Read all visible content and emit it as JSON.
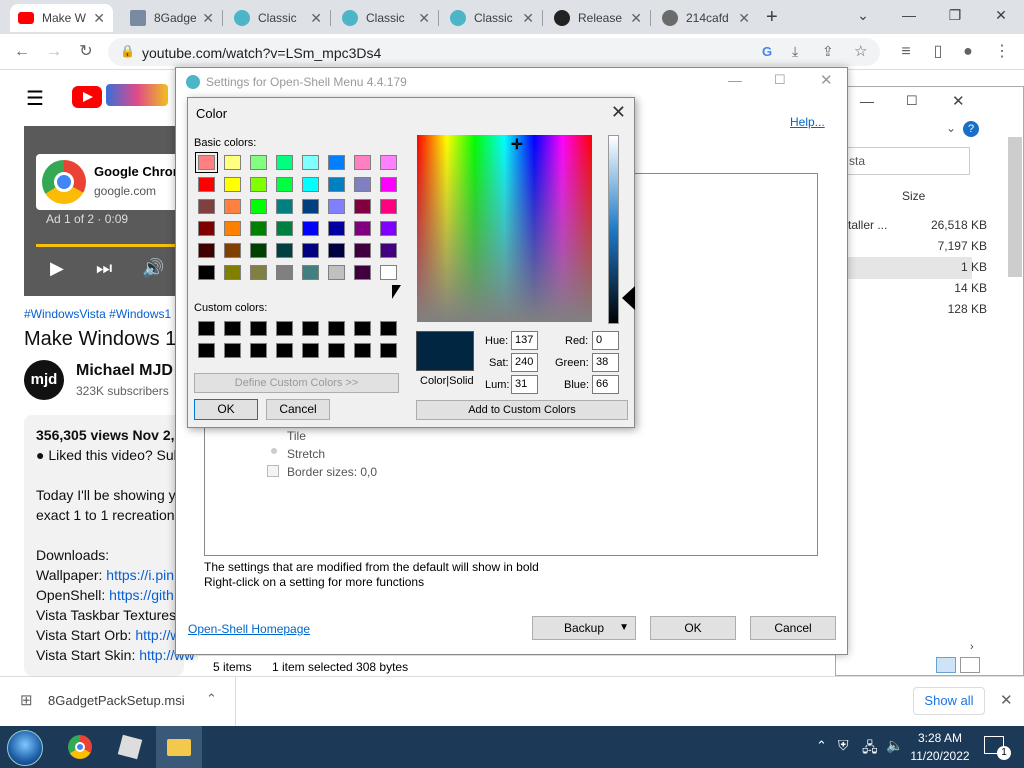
{
  "browser": {
    "tabs": [
      {
        "label": "Make W",
        "active": true
      },
      {
        "label": "8Gadge"
      },
      {
        "label": "Classic"
      },
      {
        "label": "Classic"
      },
      {
        "label": "Classic"
      },
      {
        "label": "Release"
      },
      {
        "label": "214cafd"
      }
    ],
    "new_tab": "+",
    "url": "youtube.com/watch?v=LSm_mpc3Ds4"
  },
  "youtube": {
    "ad_title": "Google Chron",
    "ad_domain": "google.com",
    "ad_meta": "Ad 1 of 2 · 0:09",
    "hashtags": "#WindowsVista #Windows1",
    "video_title": "Make Windows 10",
    "channel_name": "Michael MJD",
    "subscribers": "323K subscribers",
    "avatar_text": "mjd",
    "views": "356,305 views  Nov 2,",
    "desc_line1": "● Liked this video? Sub",
    "desc_line2": "Today I'll be showing y",
    "desc_line3": "exact 1 to 1 recreation",
    "downloads": "Downloads:",
    "wallpaper_label": "Wallpaper:",
    "wallpaper_link": "https://i.pin",
    "openshell_label": "OpenShell:",
    "openshell_link": "https://gith",
    "taskbar_textures": "Vista Taskbar Textures",
    "start_orb_label": "Vista Start Orb:",
    "start_orb_link": "http://w",
    "start_skin_label": "Vista Start Skin:",
    "start_skin_link": "http://ww"
  },
  "explorer": {
    "search_text": "sta",
    "col_size": "Size",
    "rows": [
      {
        "name": "taller ...",
        "size": "26,518 KB"
      },
      {
        "name": "",
        "size": "7,197 KB"
      },
      {
        "name": "",
        "size": "1 KB"
      },
      {
        "name": "",
        "size": "14 KB"
      },
      {
        "name": "",
        "size": "128 KB"
      }
    ],
    "status_items": "5 items",
    "status_selected": "1 item selected  308 bytes"
  },
  "openshell": {
    "title": "Settings for Open-Shell Menu 4.4.179",
    "help": "Help...",
    "options": [
      "Tile",
      "Stretch",
      "Border sizes: 0,0"
    ],
    "note1": "The settings that are modified from the default will show in bold",
    "note2": "Right-click on a setting for more functions",
    "homepage": "Open-Shell Homepage",
    "backup": "Backup",
    "ok": "OK",
    "cancel": "Cancel"
  },
  "color_dialog": {
    "title": "Color",
    "basic_colors_label": "Basic colors:",
    "custom_colors_label": "Custom colors:",
    "define_custom": "Define Custom Colors >>",
    "ok": "OK",
    "cancel": "Cancel",
    "color_solid": "Color|Solid",
    "hue_label": "Hue:",
    "hue": "137",
    "sat_label": "Sat:",
    "sat": "240",
    "lum_label": "Lum:",
    "lum": "31",
    "red_label": "Red:",
    "red": "0",
    "green_label": "Green:",
    "green": "38",
    "blue_label": "Blue:",
    "blue": "66",
    "add_custom": "Add to Custom Colors",
    "selected_color": "#002642",
    "basic_colors": [
      "#ff8080",
      "#ffff80",
      "#80ff80",
      "#00ff80",
      "#80ffff",
      "#0080ff",
      "#ff80c0",
      "#ff80ff",
      "#ff0000",
      "#ffff00",
      "#80ff00",
      "#00ff40",
      "#00ffff",
      "#0080c0",
      "#8080c0",
      "#ff00ff",
      "#804040",
      "#ff8040",
      "#00ff00",
      "#008080",
      "#004080",
      "#8080ff",
      "#800040",
      "#ff0080",
      "#800000",
      "#ff8000",
      "#008000",
      "#008040",
      "#0000ff",
      "#0000a0",
      "#800080",
      "#8000ff",
      "#400000",
      "#804000",
      "#004000",
      "#004040",
      "#000080",
      "#000040",
      "#400040",
      "#400080",
      "#000000",
      "#808000",
      "#808040",
      "#808080",
      "#408080",
      "#c0c0c0",
      "#400040",
      "#ffffff"
    ]
  },
  "downloads": {
    "file": "8GadgetPackSetup.msi",
    "show_all": "Show all"
  },
  "taskbar": {
    "time": "3:28 AM",
    "date": "11/20/2022",
    "notifications": "1"
  }
}
